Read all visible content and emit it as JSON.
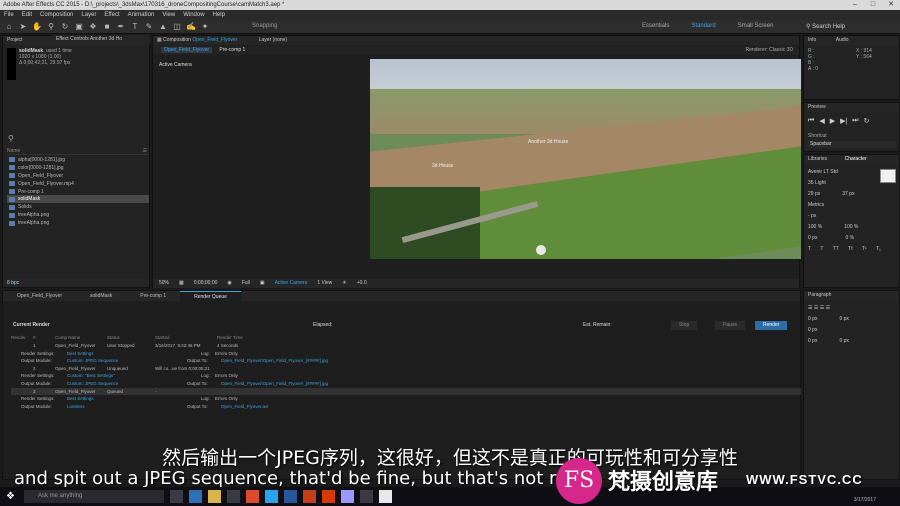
{
  "window_title": "Adobe After Effects CC 2015 - D:\\_projects\\_3dsMax\\170316_droneCompositingCourse\\camMatch3.aep *",
  "menu": [
    "File",
    "Edit",
    "Composition",
    "Layer",
    "Effect",
    "Animation",
    "View",
    "Window",
    "Help"
  ],
  "toolbar": {
    "snapping": "Snapping",
    "workspaces": [
      "Essentials",
      "Standard",
      "Small Screen"
    ],
    "search_placeholder": "Search Help"
  },
  "project": {
    "tab": "Project",
    "effects_tab": "Effect Controls Another 3d Ho",
    "selected_name": "solidMask",
    "selected_used": ", used 1 time",
    "selected_dims": "1920 x 1080 (1.00)",
    "selected_duration": "Δ 0;00;42;21, 29.97 fps",
    "column_name": "Name",
    "files": [
      {
        "name": "alpha[0000-1281].jpg",
        "selected": false
      },
      {
        "name": "color[0000-1281].jpg",
        "selected": false
      },
      {
        "name": "Open_Field_Flyover",
        "selected": false
      },
      {
        "name": "Open_Field_Flyover.mp4",
        "selected": false
      },
      {
        "name": "Pre-comp 1",
        "selected": false
      },
      {
        "name": "solidMask",
        "selected": true
      },
      {
        "name": "Solids",
        "selected": false
      },
      {
        "name": "treeAlpha.png",
        "selected": false
      },
      {
        "name": "treeAlpha.png",
        "selected": false
      }
    ],
    "bpc": "8 bpc"
  },
  "composition": {
    "tab_prefix": "Composition",
    "tab_name": "Open_Field_Flyover",
    "layer_tab": "Layer (none)",
    "subtabs": [
      "Open_Field_Flyover",
      "Pre-comp 1"
    ],
    "renderer_label": "Renderer:",
    "renderer_value": "Classic 3D",
    "camera_label": "Active Camera",
    "viewer_labels": {
      "house": "3d House",
      "another": "Another 3d House"
    },
    "controls": {
      "zoom": "50%",
      "timecode": "0;00;00;00",
      "resolution": "Full",
      "camera": "Active Camera",
      "views": "1 View",
      "exposure": "+0.0"
    }
  },
  "info": {
    "tab": "Info",
    "audio_tab": "Audio",
    "values": [
      "R :",
      "G :",
      "B :",
      "A : 0"
    ],
    "coords": [
      "X : 914",
      "Y : 564"
    ]
  },
  "preview": {
    "tab": "Preview",
    "shortcut_label": "Shortcut",
    "shortcut_value": "Spacebar",
    "buttons": [
      "⏮",
      "◀",
      "▶",
      "▶|",
      "⏭",
      "↻"
    ]
  },
  "character": {
    "libraries_tab": "Libraries",
    "tab": "Character",
    "font": "Avenir LT Std",
    "style": "35 Light",
    "size": "29 px",
    "leading": "37 px",
    "tracking": "Metrics",
    "scale_v": "100 %",
    "scale_h": "100 %",
    "baseline": "0 px",
    "tsume": "0 %",
    "stroke": "- px"
  },
  "paragraph": {
    "tab": "Paragraph",
    "values": [
      "0 px",
      "0 px",
      "0 px",
      "0 px",
      "0 px"
    ]
  },
  "timeline": {
    "tabs": [
      "Open_Field_Flyover",
      "solidMask",
      "Pre-comp 1",
      "Render Queue"
    ],
    "active_tab": 3,
    "current_render": "Current Render",
    "elapsed": "Elapsed:",
    "est_remain": "Est. Remain:",
    "stop": "Stop",
    "pause": "Pause",
    "render": "Render",
    "columns": [
      "Render",
      "#",
      "Comp Name",
      "Status",
      "Started",
      "Render Time"
    ],
    "items": [
      {
        "num": "1",
        "comp": "Open_Field_Flyover",
        "status": "User Stopped",
        "started": "3/16/2017, 9:42:46 PM",
        "time": "4 Seconds",
        "render_settings": "Best Settings",
        "output_module": "Custom: JPEG Sequence",
        "log_label": "Log:",
        "log": "Errors Only",
        "output_to_label": "Output To:",
        "output_to": "Open_Field_Flyover\\Open_Field_Flyover_[#####].jpg"
      },
      {
        "num": "2",
        "comp": "Open_Field_Flyover",
        "status": "Unqueued",
        "started": "Will co...ue from 0;00;05;21",
        "time": "",
        "render_settings": "Custom: \"Best Settings\"",
        "output_module": "Custom: JPEG Sequence",
        "log_label": "Log:",
        "log": "Errors Only",
        "output_to_label": "Output To:",
        "output_to": "Open_Field_Flyover\\Open_Field_Flyover_[#####].jpg"
      },
      {
        "num": "3",
        "comp": "Open_Field_Flyover",
        "status": "Queued",
        "started": "-",
        "time": "",
        "render_settings": "Best Settings",
        "output_module": "Lossless",
        "log_label": "Log:",
        "log": "Errors Only",
        "output_to_label": "Output To:",
        "output_to": "Open_Field_Flyover.avi"
      }
    ],
    "render_settings_label": "Render Settings:",
    "output_module_label": "Output Module:"
  },
  "subtitles": {
    "chinese": "然后输出一个JPEG序列，这很好，但这不是真正的可玩性和可分享性",
    "english": "and spit out a JPEG sequence, that'd be fine, but that's not re"
  },
  "taskbar": {
    "search_placeholder": "Ask me anything",
    "date": "3/17/2017"
  },
  "watermark": {
    "logo": "FS",
    "brand": "梵摄创意库",
    "site": "WWW.FSTVC.CC"
  },
  "colors": {
    "accent": "#3ba3e0",
    "render_button": "#2b6ea6",
    "logo": "#d6278a"
  }
}
